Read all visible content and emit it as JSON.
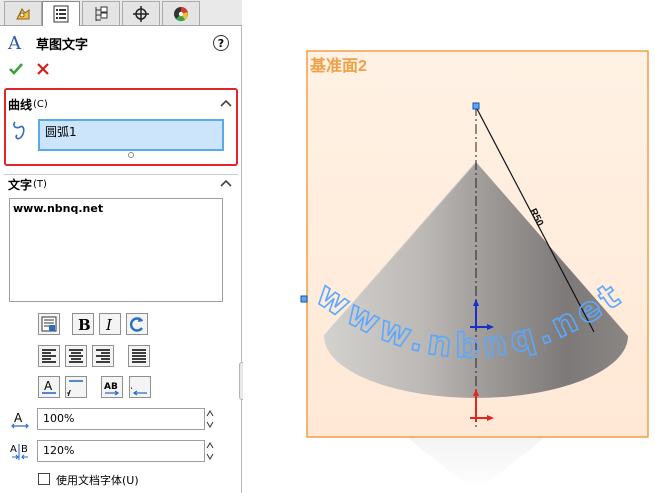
{
  "tabs": [
    {
      "name": "feature-manager-icon",
      "active": false
    },
    {
      "name": "property-manager-icon",
      "active": true
    },
    {
      "name": "configuration-manager-icon",
      "active": false
    },
    {
      "name": "dimxpert-icon",
      "active": false
    },
    {
      "name": "display-manager-icon",
      "active": false
    }
  ],
  "header": {
    "title": "草图文字",
    "help": "?"
  },
  "curve_section": {
    "title": "曲线",
    "shortcut": "(C)",
    "item": "圆弧1"
  },
  "text_section": {
    "title": "文字",
    "shortcut": "(T)",
    "content": "www.nbnq.net"
  },
  "spacing": {
    "width_factor": "100%",
    "letter_spacing": "120%"
  },
  "use_doc_font": {
    "label": "使用文档字体(U)",
    "checked": false
  },
  "viewport": {
    "plane_label": "基准面2",
    "dimension": "R50",
    "curved_text": "www.nbnq.net",
    "plane_color": "#f0a046",
    "text_color": "#5aa8ff"
  }
}
